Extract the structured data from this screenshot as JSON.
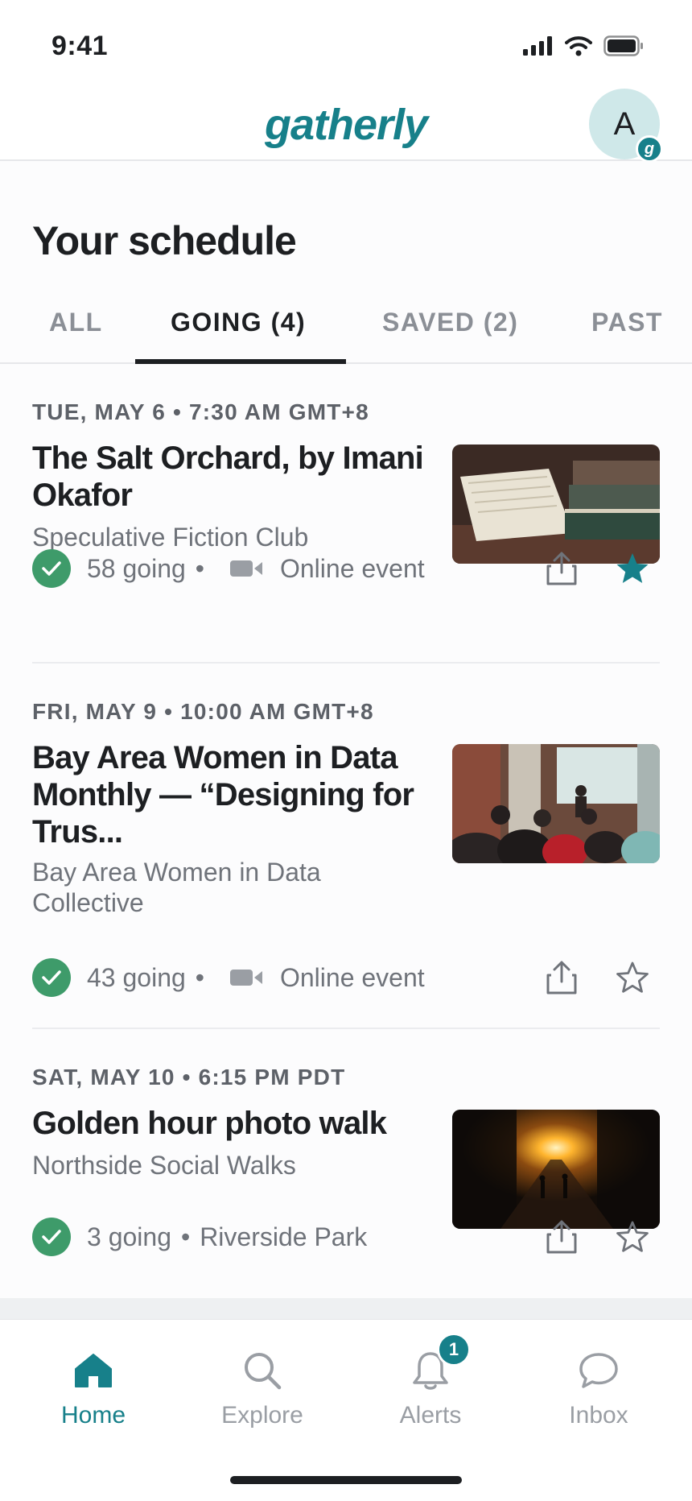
{
  "status_bar": {
    "time": "9:41"
  },
  "header": {
    "brand": "gatherly",
    "avatar_initial": "A",
    "avatar_badge": "g"
  },
  "page": {
    "title": "Your schedule"
  },
  "tabs": [
    {
      "label": "ALL",
      "active": false
    },
    {
      "label": "GOING (4)",
      "active": true
    },
    {
      "label": "SAVED (2)",
      "active": false
    },
    {
      "label": "PAST",
      "active": false
    }
  ],
  "events": [
    {
      "date": "TUE, MAY 6 • 7:30 AM GMT+8",
      "title": "The Salt Orchard, by Imani Okafor",
      "group": "Speculative Fiction Club",
      "going": "58 going",
      "location": "Online event",
      "online": true,
      "saved": true,
      "thumbnail": "stacked-books-photo"
    },
    {
      "date": "FRI, MAY 9 • 10:00 AM GMT+8",
      "title": "Bay Area Women in Data Monthly — “Designing for Trus...",
      "group": "Bay Area Women in Data Collective",
      "going": "43 going",
      "location": "Online event",
      "online": true,
      "saved": false,
      "thumbnail": "audience-at-talk-photo"
    },
    {
      "date": "SAT, MAY 10 • 6:15 PM PDT",
      "title": "Golden hour photo walk",
      "group": "Northside Social Walks",
      "going": "3 going",
      "location": "Riverside Park",
      "online": false,
      "saved": false,
      "thumbnail": "sunset-street-photo"
    }
  ],
  "bottom_nav": [
    {
      "label": "Home",
      "icon": "home-icon",
      "active": true
    },
    {
      "label": "Explore",
      "icon": "search-icon",
      "active": false
    },
    {
      "label": "Alerts",
      "icon": "bell-icon",
      "active": false,
      "badge": "1"
    },
    {
      "label": "Inbox",
      "icon": "chat-bubble-icon",
      "active": false
    }
  ],
  "colors": {
    "brand": "#17808a",
    "going_check": "#3e9b6a",
    "text_primary": "#1d1f22",
    "text_secondary": "#6f737a"
  }
}
